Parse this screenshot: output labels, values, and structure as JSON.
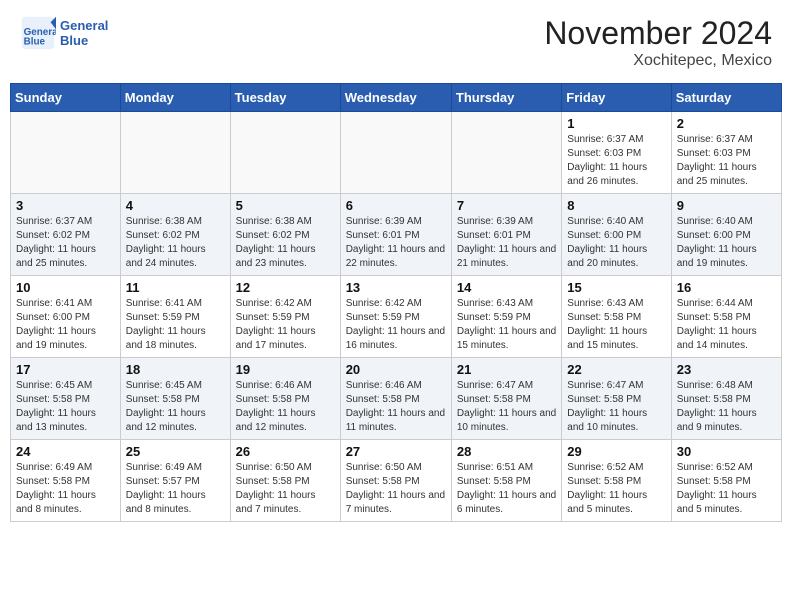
{
  "header": {
    "logo_line1": "General",
    "logo_line2": "Blue",
    "month": "November 2024",
    "location": "Xochitepec, Mexico"
  },
  "weekdays": [
    "Sunday",
    "Monday",
    "Tuesday",
    "Wednesday",
    "Thursday",
    "Friday",
    "Saturday"
  ],
  "weeks": [
    [
      {
        "day": "",
        "info": ""
      },
      {
        "day": "",
        "info": ""
      },
      {
        "day": "",
        "info": ""
      },
      {
        "day": "",
        "info": ""
      },
      {
        "day": "",
        "info": ""
      },
      {
        "day": "1",
        "info": "Sunrise: 6:37 AM\nSunset: 6:03 PM\nDaylight: 11 hours and 26 minutes."
      },
      {
        "day": "2",
        "info": "Sunrise: 6:37 AM\nSunset: 6:03 PM\nDaylight: 11 hours and 25 minutes."
      }
    ],
    [
      {
        "day": "3",
        "info": "Sunrise: 6:37 AM\nSunset: 6:02 PM\nDaylight: 11 hours and 25 minutes."
      },
      {
        "day": "4",
        "info": "Sunrise: 6:38 AM\nSunset: 6:02 PM\nDaylight: 11 hours and 24 minutes."
      },
      {
        "day": "5",
        "info": "Sunrise: 6:38 AM\nSunset: 6:02 PM\nDaylight: 11 hours and 23 minutes."
      },
      {
        "day": "6",
        "info": "Sunrise: 6:39 AM\nSunset: 6:01 PM\nDaylight: 11 hours and 22 minutes."
      },
      {
        "day": "7",
        "info": "Sunrise: 6:39 AM\nSunset: 6:01 PM\nDaylight: 11 hours and 21 minutes."
      },
      {
        "day": "8",
        "info": "Sunrise: 6:40 AM\nSunset: 6:00 PM\nDaylight: 11 hours and 20 minutes."
      },
      {
        "day": "9",
        "info": "Sunrise: 6:40 AM\nSunset: 6:00 PM\nDaylight: 11 hours and 19 minutes."
      }
    ],
    [
      {
        "day": "10",
        "info": "Sunrise: 6:41 AM\nSunset: 6:00 PM\nDaylight: 11 hours and 19 minutes."
      },
      {
        "day": "11",
        "info": "Sunrise: 6:41 AM\nSunset: 5:59 PM\nDaylight: 11 hours and 18 minutes."
      },
      {
        "day": "12",
        "info": "Sunrise: 6:42 AM\nSunset: 5:59 PM\nDaylight: 11 hours and 17 minutes."
      },
      {
        "day": "13",
        "info": "Sunrise: 6:42 AM\nSunset: 5:59 PM\nDaylight: 11 hours and 16 minutes."
      },
      {
        "day": "14",
        "info": "Sunrise: 6:43 AM\nSunset: 5:59 PM\nDaylight: 11 hours and 15 minutes."
      },
      {
        "day": "15",
        "info": "Sunrise: 6:43 AM\nSunset: 5:58 PM\nDaylight: 11 hours and 15 minutes."
      },
      {
        "day": "16",
        "info": "Sunrise: 6:44 AM\nSunset: 5:58 PM\nDaylight: 11 hours and 14 minutes."
      }
    ],
    [
      {
        "day": "17",
        "info": "Sunrise: 6:45 AM\nSunset: 5:58 PM\nDaylight: 11 hours and 13 minutes."
      },
      {
        "day": "18",
        "info": "Sunrise: 6:45 AM\nSunset: 5:58 PM\nDaylight: 11 hours and 12 minutes."
      },
      {
        "day": "19",
        "info": "Sunrise: 6:46 AM\nSunset: 5:58 PM\nDaylight: 11 hours and 12 minutes."
      },
      {
        "day": "20",
        "info": "Sunrise: 6:46 AM\nSunset: 5:58 PM\nDaylight: 11 hours and 11 minutes."
      },
      {
        "day": "21",
        "info": "Sunrise: 6:47 AM\nSunset: 5:58 PM\nDaylight: 11 hours and 10 minutes."
      },
      {
        "day": "22",
        "info": "Sunrise: 6:47 AM\nSunset: 5:58 PM\nDaylight: 11 hours and 10 minutes."
      },
      {
        "day": "23",
        "info": "Sunrise: 6:48 AM\nSunset: 5:58 PM\nDaylight: 11 hours and 9 minutes."
      }
    ],
    [
      {
        "day": "24",
        "info": "Sunrise: 6:49 AM\nSunset: 5:58 PM\nDaylight: 11 hours and 8 minutes."
      },
      {
        "day": "25",
        "info": "Sunrise: 6:49 AM\nSunset: 5:57 PM\nDaylight: 11 hours and 8 minutes."
      },
      {
        "day": "26",
        "info": "Sunrise: 6:50 AM\nSunset: 5:58 PM\nDaylight: 11 hours and 7 minutes."
      },
      {
        "day": "27",
        "info": "Sunrise: 6:50 AM\nSunset: 5:58 PM\nDaylight: 11 hours and 7 minutes."
      },
      {
        "day": "28",
        "info": "Sunrise: 6:51 AM\nSunset: 5:58 PM\nDaylight: 11 hours and 6 minutes."
      },
      {
        "day": "29",
        "info": "Sunrise: 6:52 AM\nSunset: 5:58 PM\nDaylight: 11 hours and 5 minutes."
      },
      {
        "day": "30",
        "info": "Sunrise: 6:52 AM\nSunset: 5:58 PM\nDaylight: 11 hours and 5 minutes."
      }
    ]
  ]
}
